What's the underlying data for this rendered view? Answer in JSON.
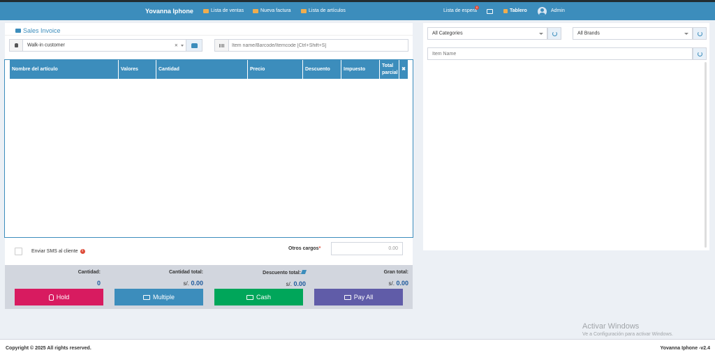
{
  "nav": {
    "brand": "Yovanna Iphone",
    "links": [
      {
        "label": "Lista de ventas",
        "icon": "list-icon"
      },
      {
        "label": "Nueva factura",
        "icon": "calculator-icon"
      },
      {
        "label": "Lista de artículos",
        "icon": "cubes-icon"
      }
    ],
    "waitlist": {
      "label": "Lista de espera",
      "count": "0"
    },
    "dashboard_label": "Tablero",
    "user_name": "Admin",
    "accent_color": "#3c8dbc"
  },
  "invoice": {
    "title": "Sales Invoice",
    "customer": {
      "value": "Walk-in customer",
      "clear": "×"
    },
    "item_search": {
      "placeholder": "Item name/Barcode/Itemcode [Ctrl+Shift+S]"
    },
    "table": {
      "headers": [
        "Nombre del artículo",
        "Valores",
        "Cantidad",
        "Precio",
        "Descuento",
        "Impuesto",
        "Total parcial",
        "✖"
      ],
      "rows": []
    },
    "sms": {
      "label": "Enviar SMS al cliente",
      "checked": false
    },
    "other_charges": {
      "label": "Otros cargos",
      "required_mark": "*",
      "value": "0.00"
    }
  },
  "summary": {
    "quantity": {
      "label": "Cantidad:",
      "value": "0"
    },
    "total_quantity": {
      "label": "Cantidad total:",
      "currency": "s/.",
      "value": "0.00"
    },
    "total_discount": {
      "label": "Descuento total:",
      "currency": "s/.",
      "value": "0.00"
    },
    "grand_total": {
      "label": "Gran total:",
      "currency": "s/.",
      "value": "0.00"
    }
  },
  "actions": [
    {
      "label": "Hold",
      "color": "#d81b60",
      "icon": "hand-icon"
    },
    {
      "label": "Multiple",
      "color": "#3c8dbc",
      "icon": "credit-card-icon"
    },
    {
      "label": "Cash",
      "color": "#00a65a",
      "icon": "money-icon"
    },
    {
      "label": "Pay All",
      "color": "#605ca8",
      "icon": "money-icon"
    }
  ],
  "catalog": {
    "category": {
      "value": "All Categories"
    },
    "brand": {
      "value": "All Brands"
    },
    "item_name": {
      "placeholder": "Item Name"
    }
  },
  "os_watermark": {
    "title": "Activar Windows",
    "subtitle": "Ve a Configuración para activar Windows."
  },
  "footer": {
    "copyright": "Copyright © 2025 All rights reserved.",
    "version": "Yovanna Iphone -v2.4"
  }
}
